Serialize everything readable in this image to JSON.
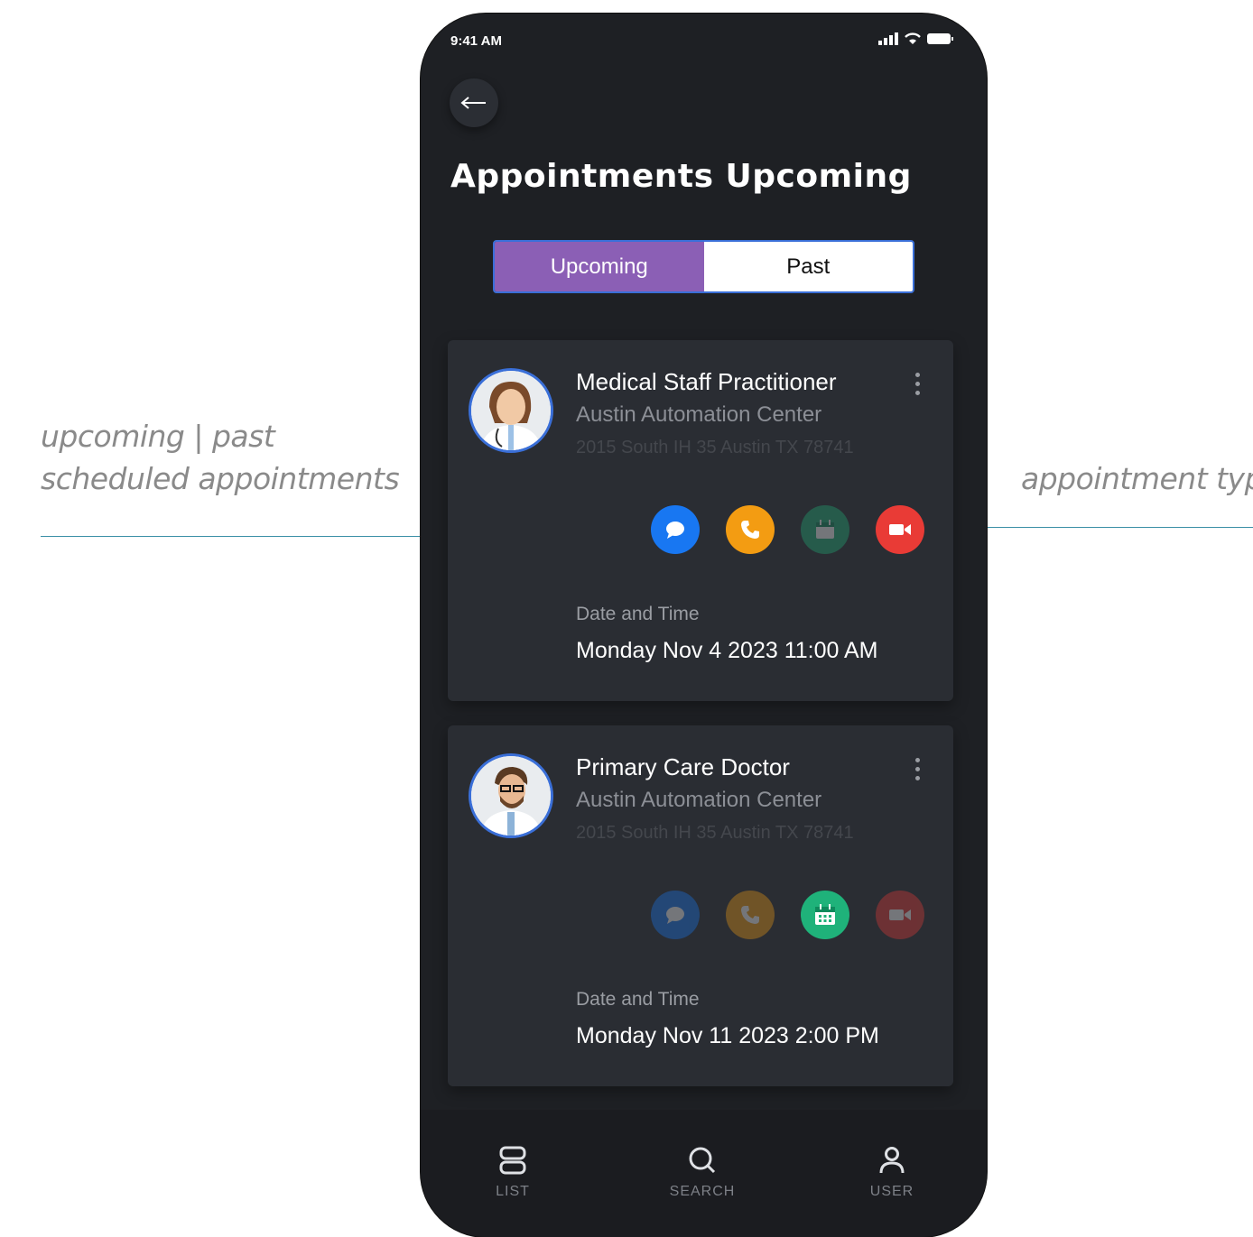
{
  "annotations": {
    "left_line1": "upcoming | past",
    "left_line2": "scheduled appointments",
    "right": "appointment type"
  },
  "status_bar": {
    "time": "9:41 AM"
  },
  "header": {
    "title": "Appointments Upcoming"
  },
  "tabs": {
    "upcoming": "Upcoming",
    "past": "Past",
    "active": "upcoming"
  },
  "appointments": [
    {
      "title": "Medical Staff Practitioner",
      "organization": "Austin Automation Center",
      "address": "2015 South IH 35 Austin TX 78741",
      "datetime_label": "Date and Time",
      "datetime": "Monday Nov 4 2023 11:00 AM",
      "active_types": [
        "message",
        "call",
        "video"
      ]
    },
    {
      "title": "Primary Care Doctor",
      "organization": "Austin Automation Center",
      "address": "2015 South IH 35 Austin TX 78741",
      "datetime_label": "Date and Time",
      "datetime": "Monday Nov 11 2023 2:00 PM",
      "active_types": [
        "in-person"
      ]
    }
  ],
  "colors": {
    "message": "#1877f2",
    "call": "#f39c12",
    "in_person": "#1fb27a",
    "video": "#e93b36",
    "tab_active": "#8b5fb5"
  },
  "bottom_nav": {
    "list": "LIST",
    "search": "SEARCH",
    "user": "USER"
  }
}
